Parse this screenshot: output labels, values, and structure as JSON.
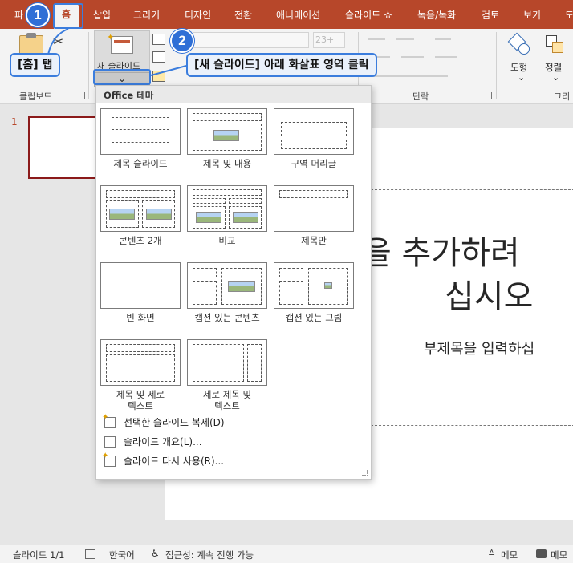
{
  "tabs": [
    {
      "label": "파",
      "active": false
    },
    {
      "label": "홈",
      "active": true
    },
    {
      "label": "삽입",
      "active": false
    },
    {
      "label": "그리기",
      "active": false
    },
    {
      "label": "디자인",
      "active": false
    },
    {
      "label": "전환",
      "active": false
    },
    {
      "label": "애니메이션",
      "active": false
    },
    {
      "label": "슬라이드 쇼",
      "active": false
    },
    {
      "label": "녹음/녹화",
      "active": false
    },
    {
      "label": "검토",
      "active": false
    },
    {
      "label": "보기",
      "active": false
    },
    {
      "label": "도",
      "active": false
    }
  ],
  "ribbon": {
    "clipboard_label": "클립보드",
    "new_slide_label": "새 슬라이드",
    "font_size": "23+",
    "paragraph_label": "단락",
    "shape_label": "도형",
    "arrange_label": "정렬",
    "drawing_label": "그리",
    "caret": "⌄"
  },
  "callouts": {
    "one_num": "1",
    "one_text": "[홈] 탭",
    "two_num": "2",
    "two_text": "[새 슬라이드] 아래 화살표 영역 클릭",
    "accent": "#2f6fd6"
  },
  "thumbnail": {
    "number": "1"
  },
  "slide": {
    "title_line1": "을 추가하려",
    "title_line2": "십시오",
    "subtitle": "부제목을 입력하십"
  },
  "panel": {
    "header": "Office 테마",
    "layouts": [
      {
        "label": "제목 슬라이드"
      },
      {
        "label": "제목 및 내용"
      },
      {
        "label": "구역 머리글"
      },
      {
        "label": "콘텐츠 2개"
      },
      {
        "label": "비교"
      },
      {
        "label": "제목만"
      },
      {
        "label": "빈 화면"
      },
      {
        "label": "캡션 있는 콘텐츠"
      },
      {
        "label": "캡션 있는 그림"
      },
      {
        "label": "제목 및 세로\n텍스트"
      },
      {
        "label": "세로 제목 및\n텍스트"
      }
    ],
    "menu": [
      {
        "label": "선택한 슬라이드 복제(D)"
      },
      {
        "label": "슬라이드 개요(L)..."
      },
      {
        "label": "슬라이드 다시 사용(R)..."
      }
    ]
  },
  "status": {
    "slide_count": "슬라이드 1/1",
    "language": "한국어",
    "accessibility": "접근성: 계속 진행 가능",
    "notes": "메모",
    "comments": "메모"
  },
  "colors": {
    "brand": "#b7472a",
    "callout_border": "#3b7ddd"
  }
}
